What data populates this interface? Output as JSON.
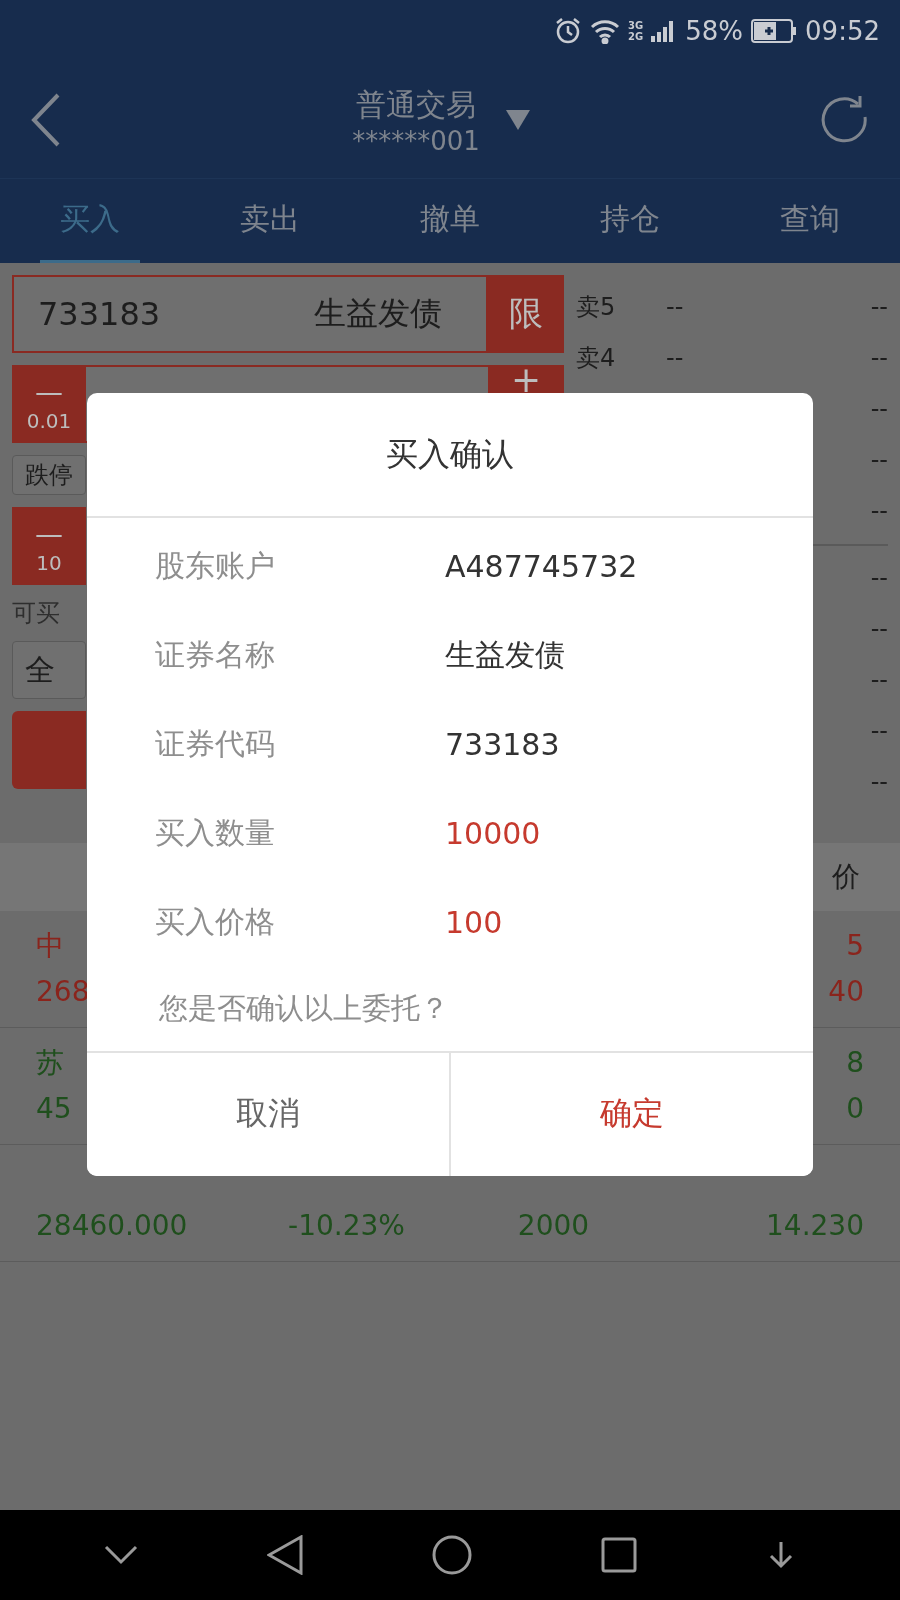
{
  "status_bar": {
    "network": [
      "3G",
      "2G"
    ],
    "battery": "58%",
    "time": "09:52"
  },
  "header": {
    "title": "普通交易",
    "account": "******001"
  },
  "tabs": [
    {
      "label": "买入",
      "selected": true
    },
    {
      "label": "卖出",
      "selected": false
    },
    {
      "label": "撤单",
      "selected": false
    },
    {
      "label": "持仓",
      "selected": false
    },
    {
      "label": "查询",
      "selected": false
    }
  ],
  "order_form": {
    "code": "733183",
    "name": "生益发债",
    "price_type": "限",
    "price_minus": "—",
    "price_step": "0.01",
    "price_plus": "+",
    "limit_down": "跌停",
    "qty_minus": "—",
    "qty_step": "10",
    "available_label": "可买",
    "position_button": "全"
  },
  "order_book": [
    {
      "label": "卖5",
      "price": "--",
      "volume": "--"
    },
    {
      "label": "卖4",
      "price": "--",
      "volume": "--"
    },
    {
      "volume": "--"
    },
    {
      "volume": "--"
    },
    {
      "volume": "--"
    },
    {
      "volume": "--",
      "divider": true
    },
    {
      "volume": "--"
    },
    {
      "volume": "--"
    },
    {
      "volume": "--"
    },
    {
      "volume": "--"
    }
  ],
  "list": {
    "header_column_4": "价",
    "rows": [
      {
        "rising": true,
        "cells": {
          "column_1": {
            "line_1": "中",
            "line_2": "268"
          },
          "column_4": {
            "line_1": "5",
            "line_2": "40"
          }
        }
      },
      {
        "rising": false,
        "cells": {
          "column_1": {
            "line_1": "苏",
            "line_2": "45"
          },
          "column_4": {
            "line_1": "8",
            "line_2": "0"
          }
        }
      },
      {
        "rising": false,
        "cells": {
          "column_1": {
            "line_2": "28460.000"
          },
          "column_2": {
            "line_2": "-10.23%"
          },
          "column_3": {
            "line_2": "2000"
          },
          "column_4": {
            "line_2": "14.230"
          }
        }
      }
    ]
  },
  "dialog": {
    "title": "买入确认",
    "fields": [
      {
        "label": "股东账户",
        "value": "A487745732",
        "highlight": false
      },
      {
        "label": "证券名称",
        "value": "生益发债",
        "highlight": false
      },
      {
        "label": "证券代码",
        "value": "733183",
        "highlight": false
      },
      {
        "label": "买入数量",
        "value": "10000",
        "highlight": true
      },
      {
        "label": "买入价格",
        "value": "100",
        "highlight": true
      }
    ],
    "question": "您是否确认以上委托？",
    "buttons": [
      {
        "label": "取消",
        "primary": false
      },
      {
        "label": "确定",
        "primary": true
      }
    ]
  }
}
